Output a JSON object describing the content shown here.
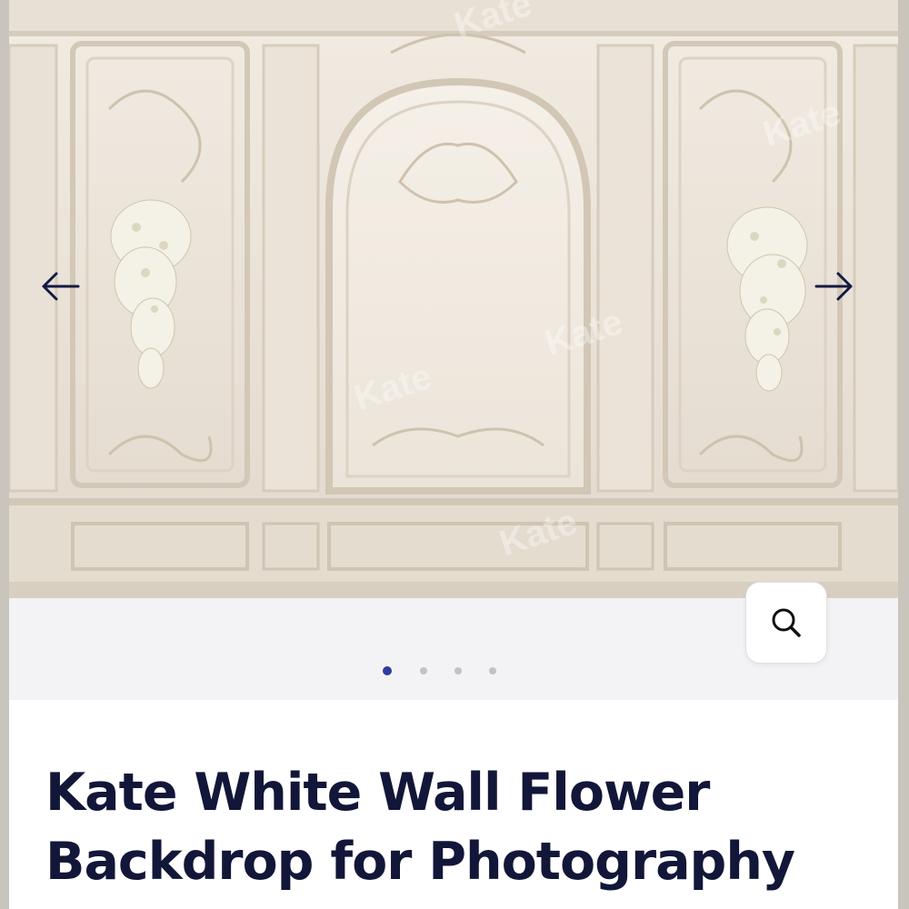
{
  "gallery": {
    "image_alt": "Kate White Wall Flower Backdrop",
    "watermark": "Kate",
    "prev_icon": "arrow-left-icon",
    "next_icon": "arrow-right-icon",
    "zoom_icon": "search-icon",
    "current_slide": 1,
    "slide_count": 4
  },
  "product": {
    "title": "Kate White Wall Flower Backdrop for Photography"
  },
  "colors": {
    "title": "#121638",
    "active_dot": "#2e3d9e",
    "inactive_dot": "#c2c2c8",
    "footer_bg": "#f3f3f5"
  }
}
